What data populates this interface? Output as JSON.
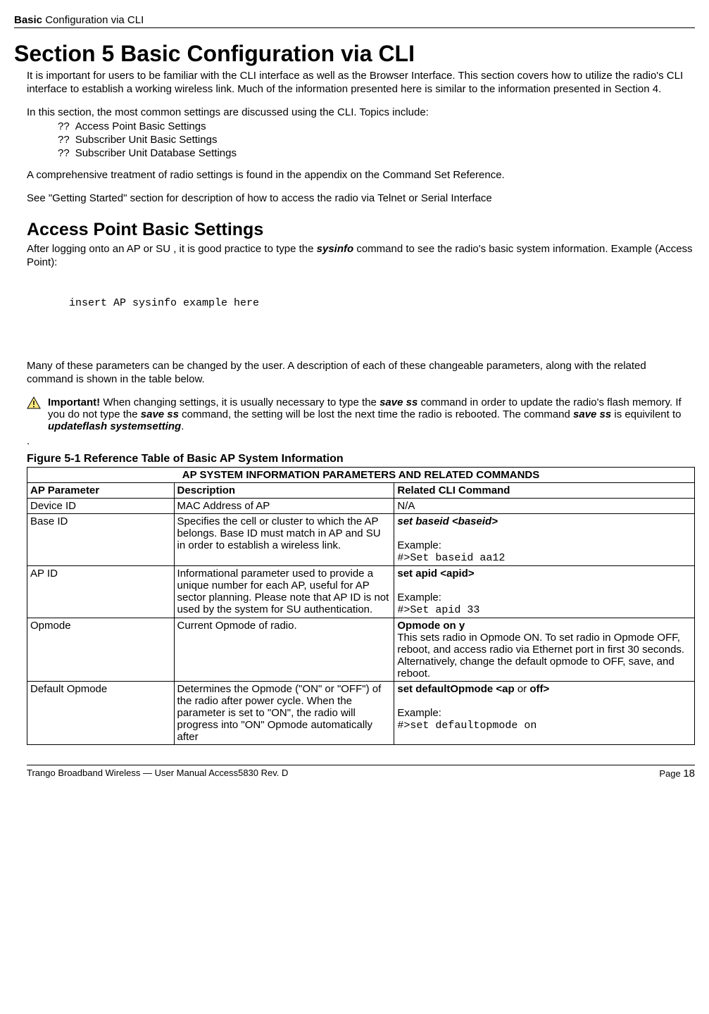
{
  "header": {
    "bold": "Basic",
    "rest": " Configuration via CLI"
  },
  "title": "Section 5    Basic Configuration via CLI",
  "intro_p1": "It is important for users to be familiar with the CLI interface as well as the Browser Interface.  This section covers how to utilize the radio's CLI interface to establish a working wireless link.  Much of the information presented here is similar to the information presented in Section 4.",
  "intro_p2": "In this section, the most common settings are discussed using the CLI.  Topics include:",
  "topics": [
    "Access Point Basic Settings",
    "Subscriber Unit Basic Settings",
    "Subscriber Unit Database Settings"
  ],
  "p_after_list": "A comprehensive treatment of radio settings is found in the appendix on the Command Set Reference.",
  "p_getting_started": "See \"Getting Started\" section for description of how to access the radio via Telnet or Serial Interface",
  "aps_heading": "Access Point Basic Settings",
  "aps_p1_a": "After logging onto an AP or SU , it is good practice to type the ",
  "aps_p1_cmd": "sysinfo",
  "aps_p1_b": " command to see the radio's basic system information.  Example (Access Point):",
  "code_block": "insert AP sysinfo example here",
  "aps_p2": "Many of these parameters can be changed by the user.  A description of each of these changeable parameters, along with the related command is shown in the table below.",
  "important_label": "Important!",
  "important_body_a": "  When changing settings, it is usually necessary to type the ",
  "important_cmd1": "save  ss",
  "important_body_b": "  command in order to update the radio's flash memory.  If you do not type the ",
  "important_cmd2": "save ss",
  "important_body_c": " command, the setting will be lost the next time the radio is rebooted.  The command ",
  "important_cmd3": "save ss",
  "important_body_d": " is equivilent to ",
  "important_cmd4": "updateflash systemsetting",
  "important_body_e": ".",
  "fig_caption": "Figure 5-1 Reference Table of Basic AP System Information",
  "table": {
    "title": "AP SYSTEM INFORMATION PARAMETERS AND RELATED COMMANDS",
    "h1": "AP Parameter",
    "h2": "Description",
    "h3": "Related CLI Command",
    "rows": [
      {
        "param": "Device ID",
        "desc": "MAC Address of AP",
        "cmd": {
          "plain": "N/A"
        }
      },
      {
        "param": "Base ID",
        "desc": "Specifies the cell or cluster to which the AP belongs. Base ID must match in AP and SU in order to establish a wireless link.",
        "cmd": {
          "bold": "set baseid <baseid>",
          "example_label": "Example:",
          "example_code": "#>Set baseid aa12"
        }
      },
      {
        "param": "AP ID",
        "desc": "Informational parameter used to provide a unique number for each AP, useful for AP sector planning.  Please note that AP ID is not used by the system for SU authentication.",
        "cmd": {
          "bold": "set apid <apid>",
          "example_label": "Example:",
          "example_code": "#>Set apid 33"
        }
      },
      {
        "param": "Opmode",
        "desc": "Current Opmode of radio.",
        "cmd": {
          "bold": "Opmode on y",
          "text": "This sets radio in Opmode ON. To set radio in Opmode OFF, reboot, and access radio via Ethernet port in first 30 seconds. Alternatively, change the default opmode to OFF, save, and reboot."
        }
      },
      {
        "param": "Default Opmode",
        "desc": "Determines the Opmode (\"ON\" or \"OFF\") of the radio after power cycle.  When the parameter is set to \"ON\", the radio will progress into \"ON\" Opmode automatically after",
        "cmd": {
          "bold_a": "set defaultOpmode <ap ",
          "plain_mid": "or",
          "bold_b": " off>",
          "example_label": "Example:",
          "example_code": "#>set defaultopmode on"
        }
      }
    ]
  },
  "footer": {
    "left": "Trango Broadband Wireless — User Manual Access5830  Rev. D",
    "right_label": "Page ",
    "right_num": "18"
  }
}
